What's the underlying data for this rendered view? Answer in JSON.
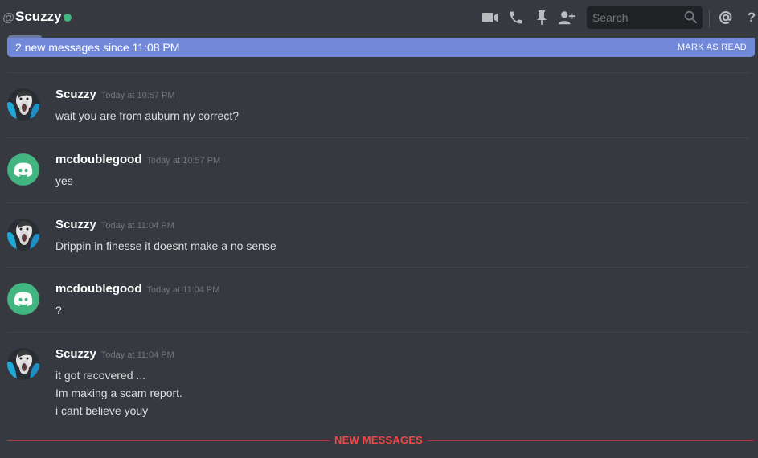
{
  "header": {
    "at_symbol": "@",
    "channel_name": "Scuzzy",
    "search_placeholder": "Search",
    "colors": {
      "status_online": "#43b581"
    },
    "icons": [
      "video-call-icon",
      "voice-call-icon",
      "pin-icon",
      "add-friend-icon",
      "search-icon",
      "mention-icon",
      "help-icon"
    ]
  },
  "banner": {
    "text": "2 new messages since 11:08 PM",
    "mark_as_read": "MARK AS READ",
    "color": "#7289da"
  },
  "messages": [
    {
      "author": "Scuzzy",
      "timestamp": "Today at 10:57 PM",
      "avatar": "scuzzy-avatar",
      "lines": [
        "wait you are from auburn ny correct?"
      ]
    },
    {
      "author": "mcdoublegood",
      "timestamp": "Today at 10:57 PM",
      "avatar": "discord-default-avatar",
      "lines": [
        "yes"
      ]
    },
    {
      "author": "Scuzzy",
      "timestamp": "Today at 11:04 PM",
      "avatar": "scuzzy-avatar",
      "lines": [
        "Drippin in finesse it doesnt make a no sense"
      ]
    },
    {
      "author": "mcdoublegood",
      "timestamp": "Today at 11:04 PM",
      "avatar": "discord-default-avatar",
      "lines": [
        "?"
      ]
    },
    {
      "author": "Scuzzy",
      "timestamp": "Today at 11:04 PM",
      "avatar": "scuzzy-avatar",
      "lines": [
        "it got recovered ...",
        "Im making a scam report.",
        "i cant believe youy"
      ]
    }
  ],
  "divider": {
    "label": "NEW MESSAGES",
    "color": "#f04747"
  }
}
